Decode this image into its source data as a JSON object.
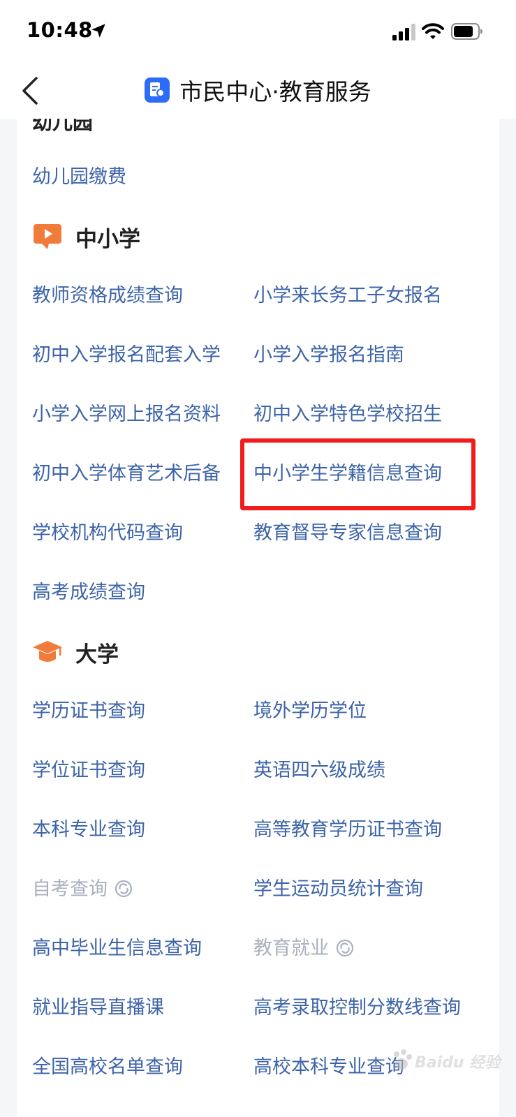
{
  "status_bar": {
    "time": "10:48",
    "icons": [
      "location-arrow-icon",
      "signal-icon",
      "wifi-icon",
      "battery-icon"
    ]
  },
  "nav": {
    "title": "市民中心·教育服务",
    "back_icon": "chevron-left-icon",
    "app_icon": "education-service-icon",
    "app_icon_color": "#2d6cf6"
  },
  "partial_section": {
    "title": "幼儿园",
    "items": [
      "幼儿园缴费"
    ]
  },
  "sections": [
    {
      "title": "中小学",
      "icon": "video-play-icon",
      "icon_color": "#f07b3b",
      "items": [
        "教师资格成绩查询",
        "小学来长务工子女报名",
        "初中入学报名配套入学",
        "小学入学报名指南",
        "小学入学网上报名资料",
        "初中入学特色学校招生",
        "初中入学体育艺术后备",
        "中小学生学籍信息查询",
        "学校机构代码查询",
        "教育督导专家信息查询",
        "高考成绩查询"
      ],
      "highlighted": "中小学生学籍信息查询"
    },
    {
      "title": "大学",
      "icon": "graduation-cap-icon",
      "icon_color": "#f07b3b",
      "items": [
        "学历证书查询",
        "境外学历学位",
        "学位证书查询",
        "英语四六级成绩",
        "本科专业查询",
        "高等教育学历证书查询",
        "自考查询",
        "学生运动员统计查询",
        "高中毕业生信息查询",
        "教育就业",
        "就业指导直播课",
        "高考录取控制分数线查询",
        "全国高校名单查询",
        "高校本科专业查询"
      ],
      "disabled_items": [
        "自考查询",
        "教育就业"
      ]
    }
  ],
  "colors": {
    "link": "#3d64a8",
    "disabled": "#a9b1bd",
    "highlight_border": "#f11d1d"
  },
  "watermark": "Baidu 经验"
}
